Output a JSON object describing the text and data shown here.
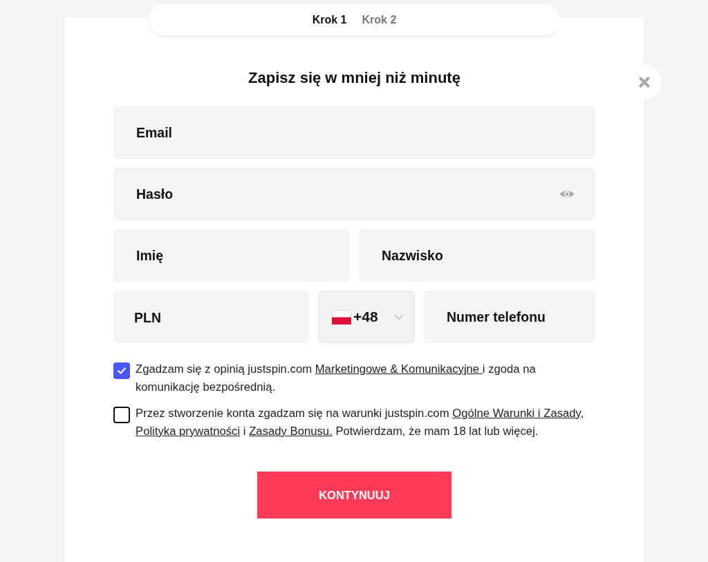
{
  "steps": [
    {
      "label": "Krok 1",
      "selected": true
    },
    {
      "label": "Krok 2",
      "selected": false
    }
  ],
  "title": "Zapisz się w mniej niż minutę",
  "form_rows": [
    [
      {
        "kind": "text",
        "placeholder": "Email"
      }
    ],
    [
      {
        "kind": "password",
        "placeholder": "Hasło"
      }
    ],
    [
      {
        "kind": "text",
        "placeholder": "Imię"
      },
      {
        "kind": "text",
        "placeholder": "Nazwisko"
      }
    ],
    [
      {
        "kind": "select",
        "value": "PLN"
      },
      {
        "kind": "phone_code",
        "value": "+48"
      },
      {
        "kind": "text",
        "placeholder": "Numer telefonu"
      }
    ]
  ],
  "consents": [
    {
      "checked": true,
      "parts": [
        {
          "kind": "text",
          "text": "Zgadzam się z opinią justspin.com "
        },
        {
          "kind": "link",
          "text": "Marketingowe & Komunikacyjne "
        },
        {
          "kind": "text",
          "text": "i zgoda na komunikację bezpośrednią."
        }
      ]
    },
    {
      "checked": false,
      "parts": [
        {
          "kind": "text",
          "text": "Przez stworzenie konta zgadzam się na warunki justspin.com "
        },
        {
          "kind": "link",
          "text": "Ogólne Warunki i Zasady"
        },
        {
          "kind": "text",
          "text": ", "
        },
        {
          "kind": "link",
          "text": "Polityka prywatności"
        },
        {
          "kind": "text",
          "text": " i "
        },
        {
          "kind": "link",
          "text": "Zasady Bonusu."
        },
        {
          "kind": "text",
          "text": " Potwierdzam, że mam 18 lat lub więcej."
        }
      ]
    }
  ],
  "submit_button": "KONTYNUUJ"
}
